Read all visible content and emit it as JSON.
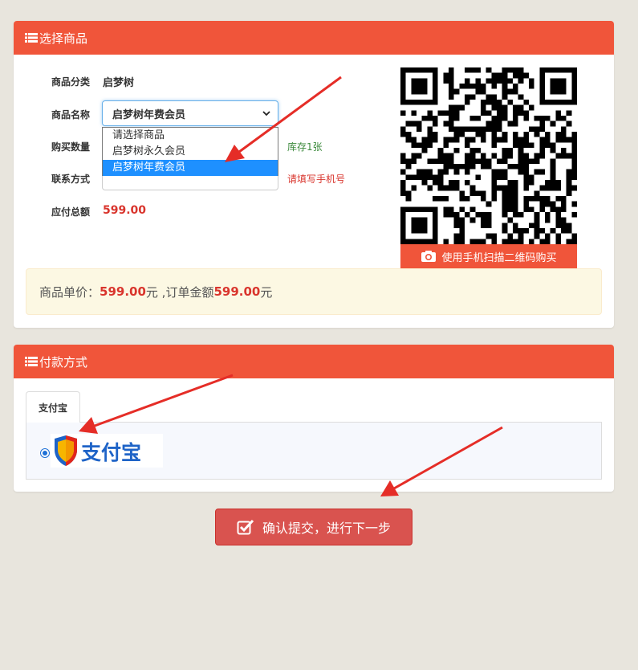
{
  "product_panel": {
    "title": "选择商品",
    "category_label": "商品分类",
    "category_value": "启梦树",
    "name_label": "商品名称",
    "selected_product": "启梦树年费会员",
    "options": [
      "请选择商品",
      "启梦树永久会员",
      "启梦树年费会员"
    ],
    "quantity_label": "购买数量",
    "stock_hint": "库存1张",
    "contact_label": "联系方式",
    "contact_hint": "请填写手机号",
    "total_label": "应付总额",
    "total_value": "599.00",
    "qr_caption": "使用手机扫描二维码购买",
    "price_text_1": "商品单价：",
    "unit_price": "599.00",
    "price_text_2": "元 ,订单金额",
    "order_amount": "599.00",
    "price_text_3": "元"
  },
  "payment_panel": {
    "title": "付款方式",
    "tab_label": "支付宝",
    "logo_text": "支付宝"
  },
  "submit_label": "确认提交，进行下一步",
  "colors": {
    "accent": "#f0553a",
    "price_red": "#d9352d",
    "button_red": "#d9534f",
    "option_selected": "#1e90ff"
  }
}
